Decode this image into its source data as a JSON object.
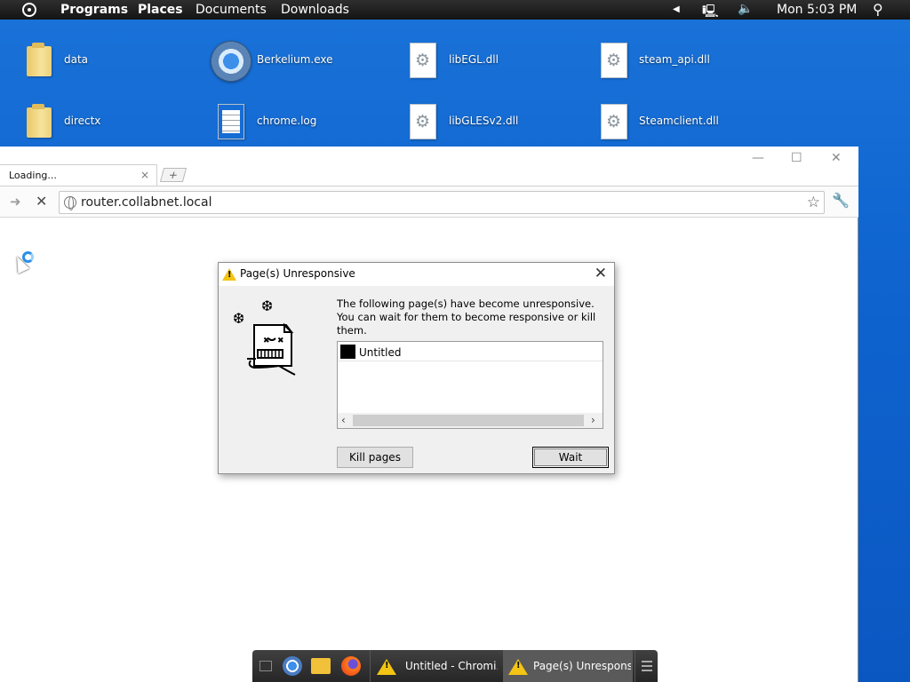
{
  "top_panel": {
    "menus": [
      "Programs",
      "Places",
      "Documents",
      "Downloads"
    ],
    "clock": "Mon 5:03 PM"
  },
  "desktop": {
    "icons": [
      {
        "label": "data",
        "kind": "folder-icon"
      },
      {
        "label": "Berkelium.exe",
        "kind": "chrome-app-icon"
      },
      {
        "label": "libEGL.dll",
        "kind": "dll-file-icon"
      },
      {
        "label": "steam_api.dll",
        "kind": "dll-file-icon"
      },
      {
        "label": "directx",
        "kind": "folder-icon"
      },
      {
        "label": "chrome.log",
        "kind": "text-file-icon"
      },
      {
        "label": "libGLESv2.dll",
        "kind": "dll-file-icon"
      },
      {
        "label": "Steamclient.dll",
        "kind": "dll-file-icon"
      }
    ]
  },
  "browser": {
    "tab_title": "Loading...",
    "address": "router.collabnet.local"
  },
  "dialog": {
    "title": "Page(s) Unresponsive",
    "message": "The following page(s) have become unresponsive. You can wait for them to become responsive or kill them.",
    "pages": [
      "Untitled"
    ],
    "kill_label": "Kill pages",
    "wait_label": "Wait"
  },
  "taskbar": {
    "items": [
      {
        "label": "Untitled - Chromi..."
      },
      {
        "label": "Page(s) Unrespons..."
      }
    ]
  },
  "colors": {
    "desktop": "#1468d4",
    "warning": "#f3c413",
    "panel": "#1e1e1e"
  }
}
